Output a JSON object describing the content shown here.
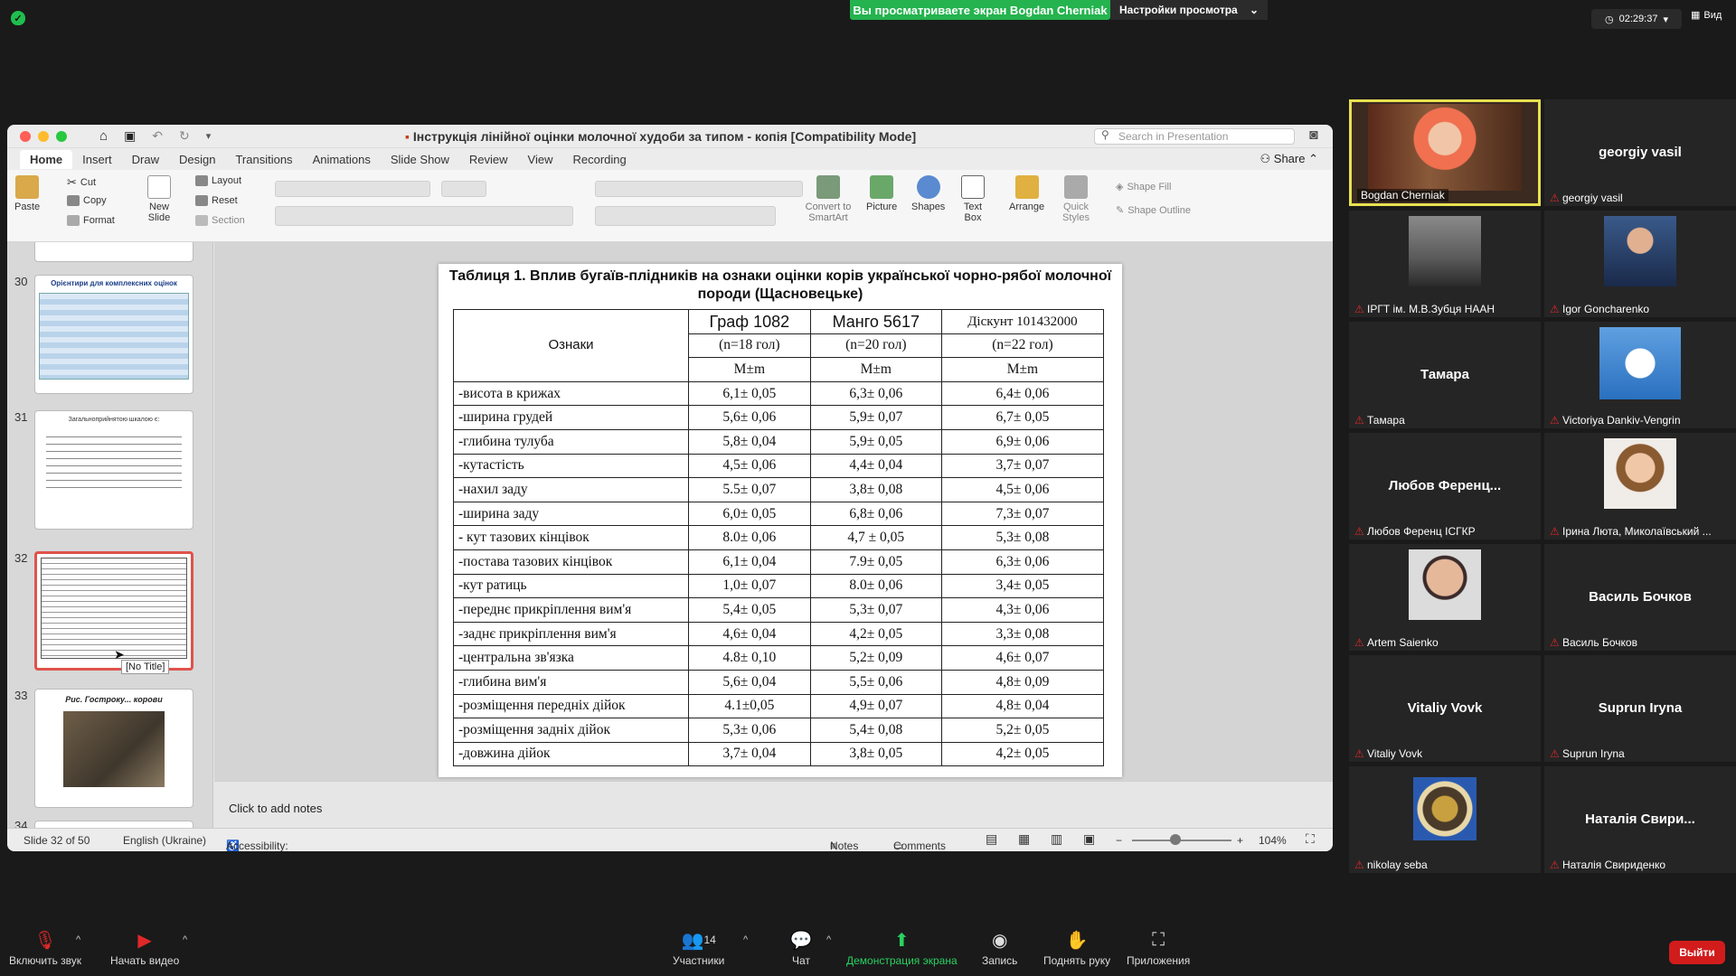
{
  "top": {
    "banner": "Вы просматриваете экран Bogdan Cherniak",
    "view_settings": "Настройки просмотра",
    "timer": "02:29:37",
    "view": "Вид"
  },
  "ppt": {
    "title": "Інструкція лінійної оцінки молочної худоби за типом - копія [Compatibility Mode]",
    "search_placeholder": "Search in Presentation",
    "share": "Share",
    "tabs": [
      "Home",
      "Insert",
      "Draw",
      "Design",
      "Transitions",
      "Animations",
      "Slide Show",
      "Review",
      "View",
      "Recording"
    ],
    "ribbon": {
      "paste": "Paste",
      "cut": "Cut",
      "copy": "Copy",
      "format": "Format",
      "new_slide": "New Slide",
      "layout": "Layout",
      "reset": "Reset",
      "section": "Section",
      "convert": "Convert to SmartArt",
      "picture": "Picture",
      "shapes": "Shapes",
      "text_box": "Text Box",
      "arrange": "Arrange",
      "quick_styles": "Quick Styles",
      "shape_fill": "Shape Fill",
      "shape_outline": "Shape Outline"
    },
    "thumbs": [
      {
        "num": "30",
        "label": "Орієнтири для комплексних оцінок"
      },
      {
        "num": "31",
        "label": "Загальноприйнятою шкалою є:"
      },
      {
        "num": "32",
        "label": "Таблиця 1"
      },
      {
        "num": "33",
        "label": "Рис. Гостроку... корови"
      },
      {
        "num": "34",
        "label": ""
      }
    ],
    "tooltip": "[No Title]",
    "notes": "Click to add notes",
    "status": {
      "slide": "Slide 32 of 50",
      "lang": "English (Ukraine)",
      "access": "Accessibility: Unavailable",
      "notes": "Notes",
      "comments": "Comments",
      "zoom": "104%"
    }
  },
  "slide": {
    "title": "Таблиця 1. Вплив бугаїв-плідників на ознаки оцінки корів української чорно-рябої молочної породи (Щасновецьке)",
    "col0": "Ознаки",
    "cols": [
      {
        "name": "Граф 1082",
        "n": "(n=18 гол)",
        "m": "М±m"
      },
      {
        "name": "Манго 5617",
        "n": "(n=20 гол)",
        "m": "М±m"
      },
      {
        "name": "Діскунт 101432000",
        "n": "(n=22 гол)",
        "m": "М±m"
      }
    ],
    "rows": [
      [
        "-висота  в  крижах",
        "6,1± 0,05",
        "6,3± 0,06",
        "6,4± 0,06"
      ],
      [
        "-ширина  грудей",
        "5,6± 0,06",
        "5,9± 0,07",
        "6,7± 0,05"
      ],
      [
        "-глибина  тулуба",
        "5,8± 0,04",
        "5,9± 0,05",
        "6,9± 0,06"
      ],
      [
        "-кутастість",
        "4,5± 0,06",
        "4,4± 0,04",
        "3,7± 0,07"
      ],
      [
        "-нахил  заду",
        "5.5± 0,07",
        "3,8± 0,08",
        "4,5± 0,06"
      ],
      [
        "-ширина  заду",
        "6,0± 0,05",
        "6,8± 0,06",
        "7,3± 0,07"
      ],
      [
        "- кут  тазових  кінцівок",
        "8.0± 0,06",
        "4,7 ± 0,05",
        "5,3± 0,08"
      ],
      [
        "-постава  тазових  кінцівок",
        "6,1± 0,04",
        "7.9± 0,05",
        "6,3± 0,06"
      ],
      [
        "-кут  ратиць",
        "1,0± 0,07",
        "8.0± 0,06",
        "3,4± 0,05"
      ],
      [
        "-переднє  прикріплення  вим'я",
        "5,4± 0,05",
        "5,3± 0,07",
        "4,3± 0,06"
      ],
      [
        "-заднє  прикріплення  вим'я",
        "4,6± 0,04",
        "4,2± 0,05",
        "3,3± 0,08"
      ],
      [
        "-центральна  зв'язка",
        "4.8± 0,10",
        "5,2± 0,09",
        "4,6± 0,07"
      ],
      [
        "-глибина  вим'я",
        "5,6± 0,04",
        "5,5± 0,06",
        "4,8± 0,09"
      ],
      [
        "-розміщення  передніх  дійок",
        "4.1±0,05",
        "4,9± 0,07",
        "4,8± 0,04"
      ],
      [
        "-розміщення  задніх  дійок",
        "5,3± 0,06",
        "5,4± 0,08",
        "5,2± 0,05"
      ],
      [
        "-довжина  дійок",
        "3,7± 0,04",
        "3,8± 0,05",
        "4,2± 0,05"
      ]
    ]
  },
  "participants": [
    {
      "name": "Bogdan Cherniak",
      "big": "",
      "photo": "woman-speaker",
      "active": true
    },
    {
      "name": "georgiy vasil",
      "big": "georgiy vasil",
      "photo": ""
    },
    {
      "name": "ІРГТ ім. М.В.Зубця НААН",
      "big": "",
      "photo": "building"
    },
    {
      "name": "Igor Goncharenko",
      "big": "",
      "photo": "man-suit"
    },
    {
      "name": "Тамара",
      "big": "Тамара",
      "photo": ""
    },
    {
      "name": "Victoriya Dankiv-Vengrin",
      "big": "",
      "photo": "dove"
    },
    {
      "name": "Любов Ференц ІСГКР",
      "big": "Любов  Ференц...",
      "photo": ""
    },
    {
      "name": "Ірина Люта, Миколаївський ...",
      "big": "",
      "photo": "woman"
    },
    {
      "name": "Artem Saienko",
      "big": "",
      "photo": "man-glasses"
    },
    {
      "name": "Василь Бочков",
      "big": "Василь Бочков",
      "photo": ""
    },
    {
      "name": "Vitaliy Vovk",
      "big": "Vitaliy Vovk",
      "photo": ""
    },
    {
      "name": "Suprun Iryna",
      "big": "Suprun Iryna",
      "photo": ""
    },
    {
      "name": "nikolay seba",
      "big": "",
      "photo": "emblem"
    },
    {
      "name": "Наталія Свириденко",
      "big": "Наталія  Свири...",
      "photo": ""
    }
  ],
  "bottom": {
    "mic": "Включить звук",
    "video": "Начать видео",
    "participants_count": "14",
    "participants": "Участники",
    "chat": "Чат",
    "share": "Демонстрация экрана",
    "record": "Запись",
    "hand": "Поднять руку",
    "apps": "Приложения",
    "exit": "Выйти"
  }
}
